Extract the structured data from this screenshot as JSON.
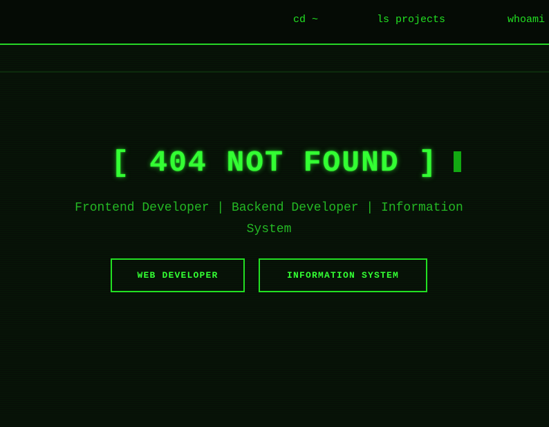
{
  "nav": {
    "items": [
      {
        "label": "cd ~"
      },
      {
        "label": "ls projects"
      },
      {
        "label": "whoami"
      }
    ]
  },
  "hero": {
    "title": "[ 404 NOT FOUND ]",
    "subtitle": "Frontend Developer | Backend Developer | Information System"
  },
  "buttons": {
    "web_developer": "WEB DEVELOPER",
    "information_system": "INFORMATION SYSTEM"
  },
  "colors": {
    "background": "#071007",
    "accent": "#33ff33",
    "text_dim": "#24b824",
    "cursor": "#12a812"
  }
}
